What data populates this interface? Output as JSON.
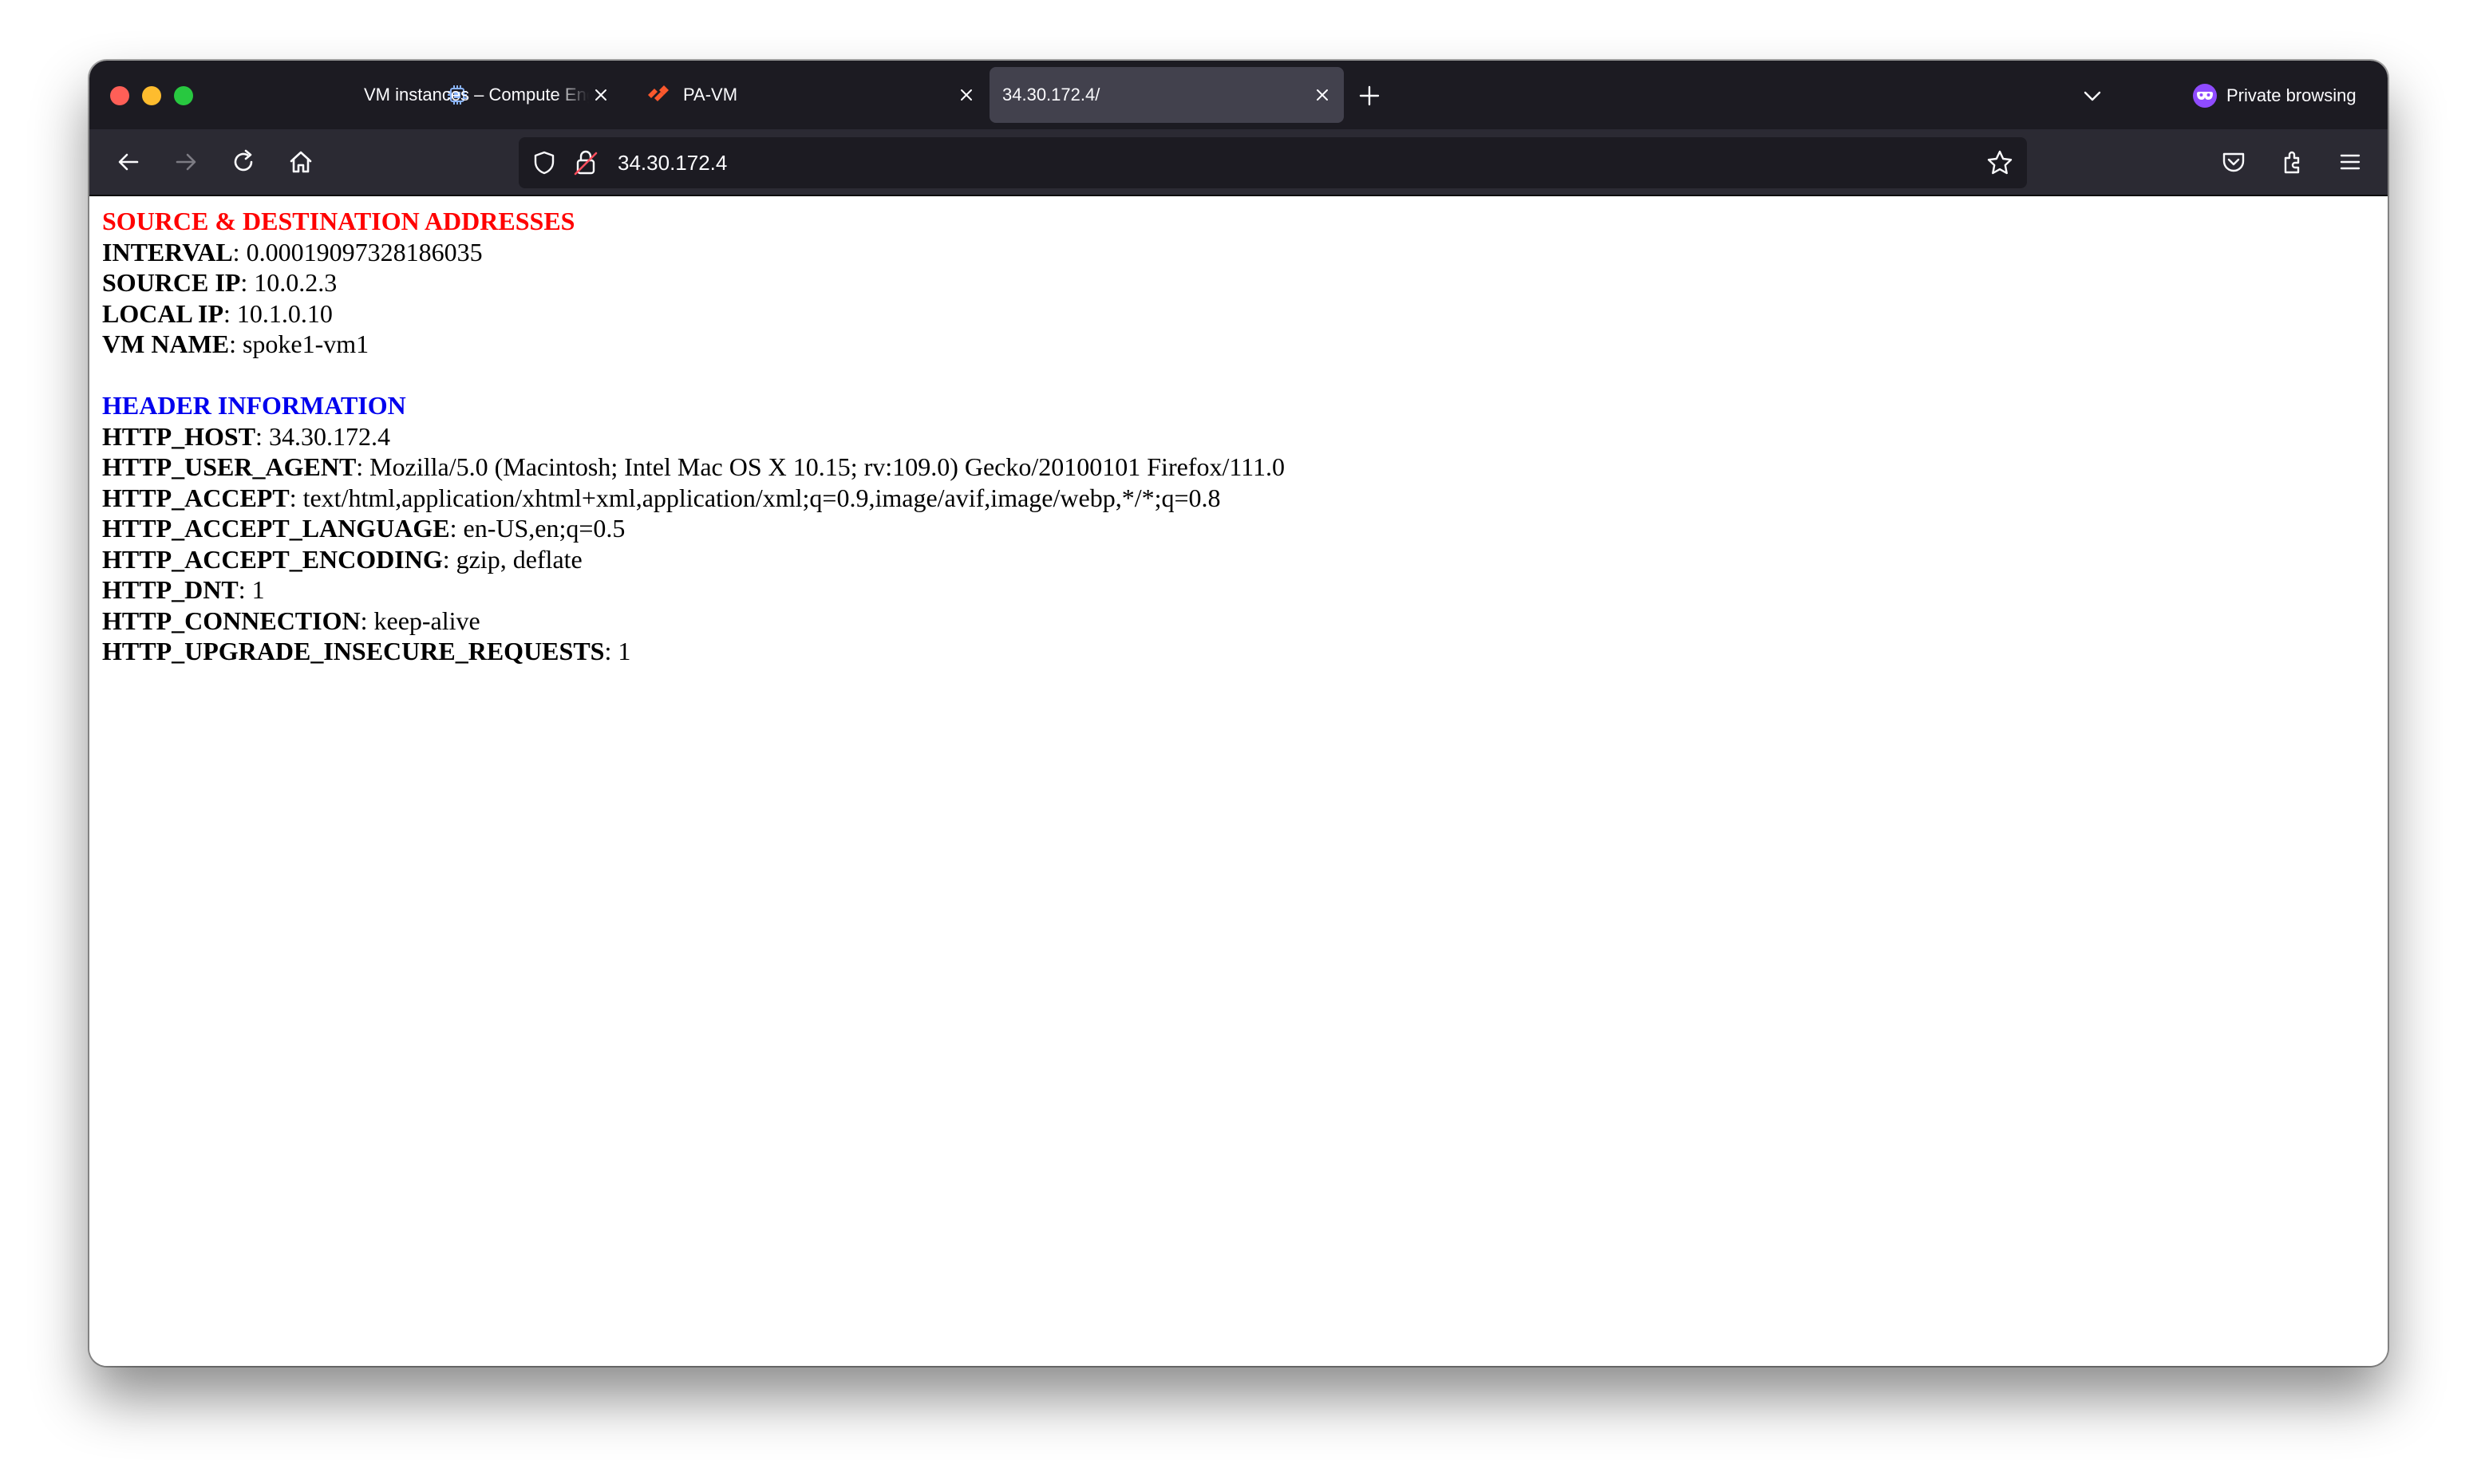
{
  "window": {
    "tabs": [
      {
        "title": "VM instances – Compute Engine",
        "favicon": "chip-icon",
        "active": false
      },
      {
        "title": "PA-VM",
        "favicon": "paloalto-icon",
        "active": false
      },
      {
        "title": "34.30.172.4/",
        "favicon": "",
        "active": true
      }
    ],
    "private_label": "Private browsing"
  },
  "navbar": {
    "url": "34.30.172.4"
  },
  "page": {
    "section1_title": "SOURCE & DESTINATION ADDRESSES",
    "section1": [
      {
        "key": "INTERVAL",
        "value": ": 0.00019097328186035"
      },
      {
        "key": "SOURCE IP",
        "value": ": 10.0.2.3"
      },
      {
        "key": "LOCAL IP",
        "value": ": 10.1.0.10"
      },
      {
        "key": "VM NAME",
        "value": ": spoke1-vm1"
      }
    ],
    "section2_title": "HEADER INFORMATION",
    "section2": [
      {
        "key": "HTTP_HOST",
        "value": ": 34.30.172.4"
      },
      {
        "key": "HTTP_USER_AGENT",
        "value": ": Mozilla/5.0 (Macintosh; Intel Mac OS X 10.15; rv:109.0) Gecko/20100101 Firefox/111.0"
      },
      {
        "key": "HTTP_ACCEPT",
        "value": ": text/html,application/xhtml+xml,application/xml;q=0.9,image/avif,image/webp,*/*;q=0.8"
      },
      {
        "key": "HTTP_ACCEPT_LANGUAGE",
        "value": ": en-US,en;q=0.5"
      },
      {
        "key": "HTTP_ACCEPT_ENCODING",
        "value": ": gzip, deflate"
      },
      {
        "key": "HTTP_DNT",
        "value": ": 1"
      },
      {
        "key": "HTTP_CONNECTION",
        "value": ": keep-alive"
      },
      {
        "key": "HTTP_UPGRADE_INSECURE_REQUESTS",
        "value": ": 1"
      }
    ]
  },
  "colors": {
    "section1_title": "#ff0000",
    "section2_title": "#0000ee",
    "chrome_dark": "#1c1b22",
    "toolbar": "#2b2a33",
    "active_tab": "#42414d"
  }
}
